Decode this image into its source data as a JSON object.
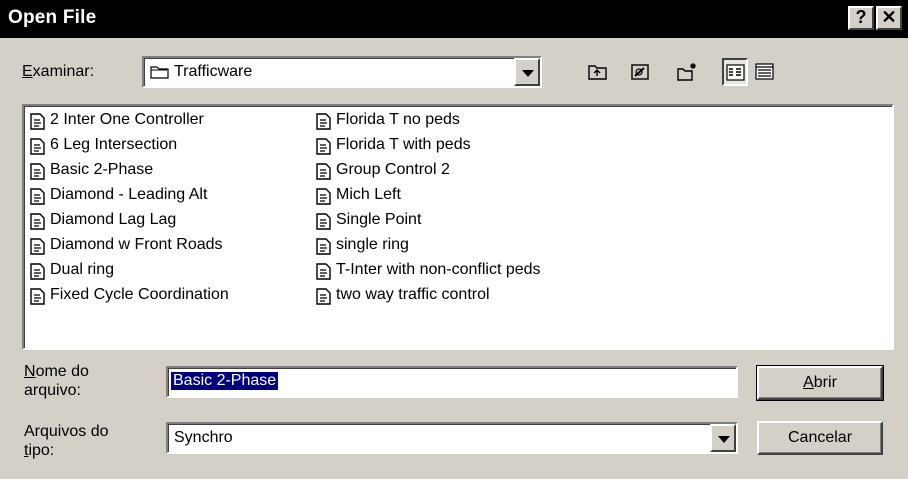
{
  "window": {
    "title": "Open File",
    "help_label": "?",
    "close_label": "✕"
  },
  "lookin": {
    "label_first": "E",
    "label_rest": "xaminar:",
    "value": "Trafficware"
  },
  "toolbar": {
    "icons": [
      "up-folder-icon",
      "desktop-icon",
      "new-folder-icon",
      "list-view-icon",
      "details-view-icon"
    ]
  },
  "files": {
    "column1": [
      "2 Inter One Controller",
      "6 Leg Intersection",
      "Basic 2-Phase",
      "Diamond - Leading Alt",
      "Diamond Lag Lag",
      "Diamond w Front Roads",
      "Dual ring",
      "Fixed Cycle Coordination"
    ],
    "column2": [
      "Florida T no peds",
      "Florida T with peds",
      "Group Control 2",
      "Mich Left",
      "Single Point",
      "single ring",
      "T-Inter with non-conflict peds",
      "two way traffic control"
    ]
  },
  "filename": {
    "label_line1_first": "N",
    "label_line1_rest": "ome do",
    "label_line2": "arquivo:",
    "value": "Basic 2-Phase"
  },
  "filetype": {
    "label_line1": "Arquivos do",
    "label_line2_first": "t",
    "label_line2_rest": "ipo:",
    "value": "Synchro"
  },
  "buttons": {
    "open_first": "A",
    "open_rest": "brir",
    "cancel": "Cancelar"
  },
  "colors": {
    "dialog_bg": "#d4d0c8",
    "titlebar_bg": "#000000",
    "selection_bg": "#000080"
  }
}
